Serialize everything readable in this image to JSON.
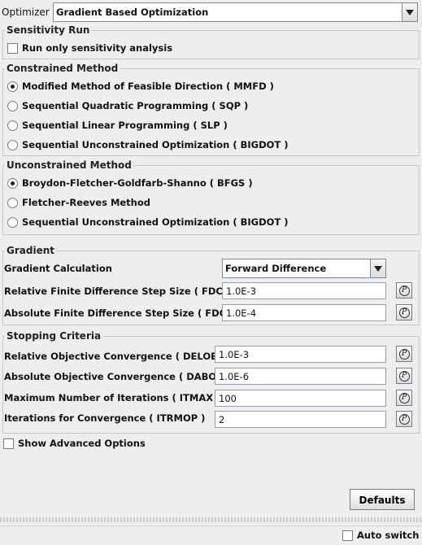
{
  "optimizer": {
    "label": "Optimizer",
    "selected": "Gradient Based Optimization"
  },
  "sensitivity": {
    "title": "Sensitivity Run",
    "checkbox_label": "Run only sensitivity analysis"
  },
  "constrained": {
    "title": "Constrained Method",
    "options": [
      {
        "label": "Modified Method of Feasible Direction ( MMFD )",
        "selected": true
      },
      {
        "label": "Sequential Quadratic Programming ( SQP )",
        "selected": false
      },
      {
        "label": "Sequential Linear Programming ( SLP )",
        "selected": false
      },
      {
        "label": "Sequential Unconstrained Optimization ( BIGDOT )",
        "selected": false
      }
    ]
  },
  "unconstrained": {
    "title": "Unconstrained Method",
    "options": [
      {
        "label": "Broydon-Fletcher-Goldfarb-Shanno ( BFGS )",
        "selected": true
      },
      {
        "label": "Fletcher-Reeves Method",
        "selected": false
      },
      {
        "label": "Sequential Unconstrained Optimization ( BIGDOT )",
        "selected": false
      }
    ]
  },
  "gradient": {
    "title": "Gradient",
    "calc_label": "Gradient Calculation",
    "calc_value": "Forward Difference",
    "fdch_label": "Relative Finite Difference Step Size ( FDCH )",
    "fdch_value": "1.0E-3",
    "fdchm_label": "Absolute Finite Difference Step Size ( FDCHM )",
    "fdchm_value": "1.0E-4"
  },
  "stopping": {
    "title": "Stopping Criteria",
    "delobj_label": "Relative Objective Convergence ( DELOBJ )",
    "delobj_value": "1.0E-3",
    "dabobj_label": "Absolute Objective Convergence ( DABOBJ )",
    "dabobj_value": "1.0E-6",
    "itmax_label": "Maximum Number of Iterations ( ITMAX )",
    "itmax_value": "100",
    "itrmop_label": "Iterations for Convergence ( ITRMOP )",
    "itrmop_value": "2"
  },
  "advanced": {
    "label": "Show Advanced Options"
  },
  "defaults_label": "Defaults",
  "status": {
    "auto_switch_label": "Auto switch"
  },
  "icons": {
    "param": "P"
  }
}
